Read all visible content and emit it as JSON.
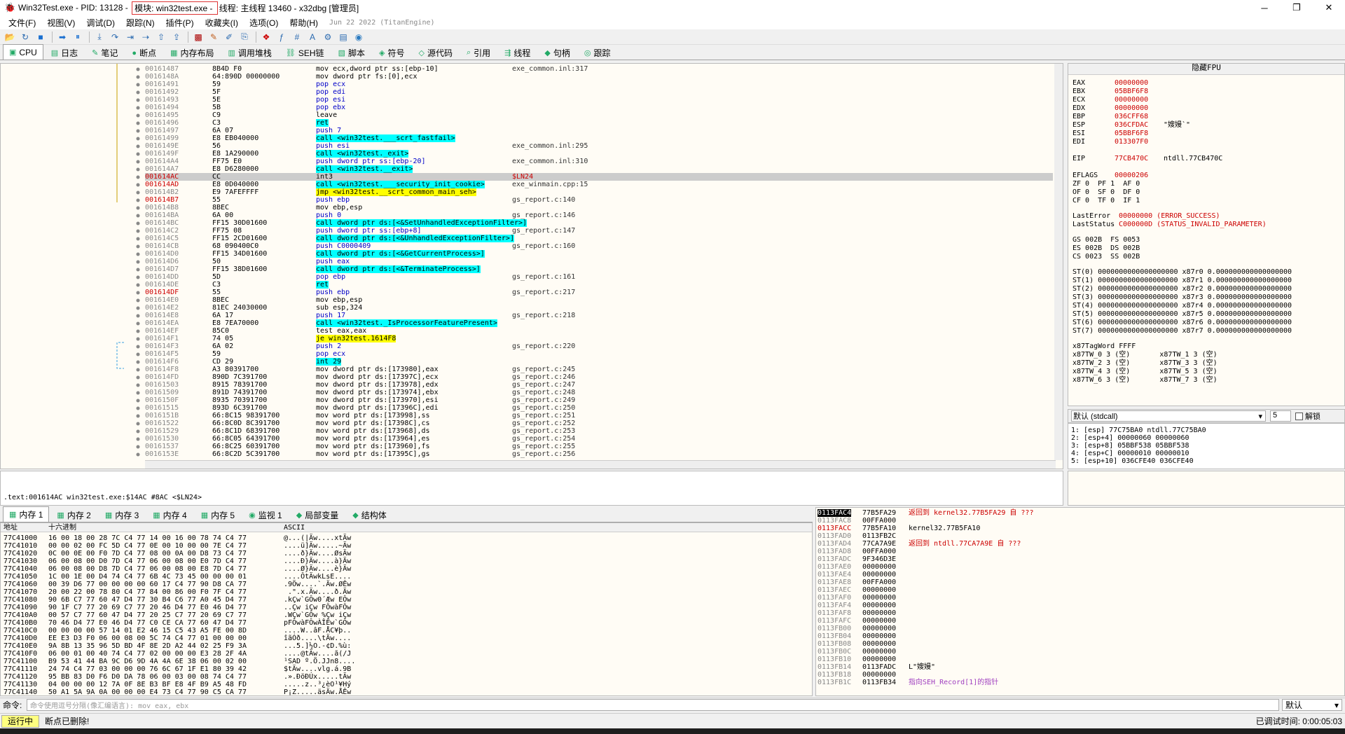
{
  "titlebar": {
    "app": "Win32Test.exe - PID: 13128 - ",
    "module": "模块: win32test.exe - ",
    "thread": "线程: 主线程 13460 - x32dbg [管理员]",
    "buttons": [
      "─",
      "❐",
      "✕"
    ]
  },
  "menu": [
    "文件(F)",
    "视图(V)",
    "调试(D)",
    "跟踪(N)",
    "插件(P)",
    "收藏夹(I)",
    "选项(O)",
    "帮助(H)"
  ],
  "menu_date": "Jun 22 2022 (TitanEngine)",
  "toolbar_icons": [
    "open-icon",
    "restart-icon",
    "stop-icon",
    "run-icon",
    "pause-icon",
    "step-into-icon",
    "step-over-icon",
    "trace-into-icon",
    "trace-over-icon",
    "execute-till-return-icon",
    "run-to-user-code-icon",
    "scylla-icon",
    "patch-icon",
    "comment-icon",
    "label-icon",
    "bookmark-icon",
    "function-icon",
    "hash-icon",
    "font-icon",
    "settings-icon",
    "calculator-icon",
    "globe-icon"
  ],
  "tabs": [
    {
      "label": "CPU",
      "icon": "▣"
    },
    {
      "label": "日志",
      "icon": "▤"
    },
    {
      "label": "笔记",
      "icon": "✎"
    },
    {
      "label": "断点",
      "icon": "●"
    },
    {
      "label": "内存布局",
      "icon": "▦"
    },
    {
      "label": "调用堆栈",
      "icon": "▥"
    },
    {
      "label": "SEH链",
      "icon": "⛓"
    },
    {
      "label": "脚本",
      "icon": "▧"
    },
    {
      "label": "符号",
      "icon": "◈"
    },
    {
      "label": "源代码",
      "icon": "◇"
    },
    {
      "label": "引用",
      "icon": "⌕"
    },
    {
      "label": "线程",
      "icon": "⇶"
    },
    {
      "label": "句柄",
      "icon": "◆"
    },
    {
      "label": "跟踪",
      "icon": "◎"
    }
  ],
  "disasm": [
    [
      "00161487",
      "8B4D F0",
      "mov ecx,dword ptr ss:[ebp-10]",
      "exe_common.inl:317"
    ],
    [
      "0016148A",
      "64:890D 00000000",
      "mov dword ptr fs:[0],ecx",
      ""
    ],
    [
      "00161491",
      "59",
      "pop ecx",
      ""
    ],
    [
      "00161492",
      "5F",
      "pop edi",
      ""
    ],
    [
      "00161493",
      "5E",
      "pop esi",
      ""
    ],
    [
      "00161494",
      "5B",
      "pop ebx",
      ""
    ],
    [
      "00161495",
      "C9",
      "leave",
      ""
    ],
    [
      "00161496",
      "C3",
      "ret",
      ""
    ],
    [
      "00161497",
      "6A 07",
      "push 7",
      ""
    ],
    [
      "00161499",
      "E8 EB040000",
      "call <win32test.___scrt_fastfail>",
      ""
    ],
    [
      "0016149E",
      "56",
      "push esi",
      "exe_common.inl:295"
    ],
    [
      "0016149F",
      "E8 1A290000",
      "call <win32test._exit>",
      ""
    ],
    [
      "001614A4",
      "FF75 E0",
      "push dword ptr ss:[ebp-20]",
      "exe_common.inl:310"
    ],
    [
      "001614A7",
      "E8 D6280000",
      "call <win32test.__exit>",
      ""
    ],
    [
      "001614AC",
      "CC",
      "int3",
      "$LN24"
    ],
    [
      "001614AD",
      "E8 0D040000",
      "call <win32test.___security_init_cookie>",
      "exe_winmain.cpp:15"
    ],
    [
      "001614B2",
      "E9 7AFEFFFF",
      "jmp <win32test.__scrt_common_main_seh>",
      ""
    ],
    [
      "001614B7",
      "55",
      "push ebp",
      "gs_report.c:140"
    ],
    [
      "001614B8",
      "8BEC",
      "mov ebp,esp",
      ""
    ],
    [
      "001614BA",
      "6A 00",
      "push 0",
      "gs_report.c:146"
    ],
    [
      "001614BC",
      "FF15 30D01600",
      "call dword ptr ds:[<&SetUnhandledExceptionFilter>]",
      ""
    ],
    [
      "001614C2",
      "FF75 08",
      "push dword ptr ss:[ebp+8]",
      "gs_report.c:147"
    ],
    [
      "001614C5",
      "FF15 2CD01600",
      "call dword ptr ds:[<&UnhandledExceptionFilter>]",
      ""
    ],
    [
      "001614CB",
      "68 090400C0",
      "push C0000409",
      "gs_report.c:160"
    ],
    [
      "001614D0",
      "FF15 34D01600",
      "call dword ptr ds:[<&GetCurrentProcess>]",
      ""
    ],
    [
      "001614D6",
      "50",
      "push eax",
      ""
    ],
    [
      "001614D7",
      "FF15 38D01600",
      "call dword ptr ds:[<&TerminateProcess>]",
      ""
    ],
    [
      "001614DD",
      "5D",
      "pop ebp",
      "gs_report.c:161"
    ],
    [
      "001614DE",
      "C3",
      "ret",
      ""
    ],
    [
      "001614DF",
      "55",
      "push ebp",
      "gs_report.c:217"
    ],
    [
      "001614E0",
      "8BEC",
      "mov ebp,esp",
      ""
    ],
    [
      "001614E2",
      "81EC 24030000",
      "sub esp,324",
      ""
    ],
    [
      "001614E8",
      "6A 17",
      "push 17",
      "gs_report.c:218"
    ],
    [
      "001614EA",
      "E8 7EA70000",
      "call <win32test._IsProcessorFeaturePresent>",
      ""
    ],
    [
      "001614EF",
      "85C0",
      "test eax,eax",
      ""
    ],
    [
      "001614F1",
      "74 05",
      "je win32test.1614F8",
      ""
    ],
    [
      "001614F3",
      "6A 02",
      "push 2",
      "gs_report.c:220"
    ],
    [
      "001614F5",
      "59",
      "pop ecx",
      ""
    ],
    [
      "001614F6",
      "CD 29",
      "int 29",
      ""
    ],
    [
      "001614F8",
      "A3 80391700",
      "mov dword ptr ds:[173980],eax",
      "gs_report.c:245"
    ],
    [
      "001614FD",
      "890D 7C391700",
      "mov dword ptr ds:[17397C],ecx",
      "gs_report.c:246"
    ],
    [
      "00161503",
      "8915 78391700",
      "mov dword ptr ds:[173978],edx",
      "gs_report.c:247"
    ],
    [
      "00161509",
      "891D 74391700",
      "mov dword ptr ds:[173974],ebx",
      "gs_report.c:248"
    ],
    [
      "0016150F",
      "8935 70391700",
      "mov dword ptr ds:[173970],esi",
      "gs_report.c:249"
    ],
    [
      "00161515",
      "893D 6C391700",
      "mov dword ptr ds:[17396C],edi",
      "gs_report.c:250"
    ],
    [
      "0016151B",
      "66:8C15 98391700",
      "mov word ptr ds:[173998],ss",
      "gs_report.c:251"
    ],
    [
      "00161522",
      "66:8C0D 8C391700",
      "mov word ptr ds:[17398C],cs",
      "gs_report.c:252"
    ],
    [
      "00161529",
      "66:8C1D 68391700",
      "mov word ptr ds:[173968],ds",
      "gs_report.c:253"
    ],
    [
      "00161530",
      "66:8C05 64391700",
      "mov word ptr ds:[173964],es",
      "gs_report.c:254"
    ],
    [
      "00161537",
      "66:8C25 60391700",
      "mov word ptr ds:[173960],fs",
      "gs_report.c:255"
    ],
    [
      "0016153E",
      "66:8C2D 5C391700",
      "mov word ptr ds:[17395C],gs",
      "gs_report.c:256"
    ]
  ],
  "selected_row": 14,
  "red_addr_rows": [
    14,
    15,
    17,
    29
  ],
  "registers": {
    "header": "隐藏FPU",
    "lines": [
      [
        "EAX",
        "00000000",
        ""
      ],
      [
        "EBX",
        "05BBF6F8",
        ""
      ],
      [
        "ECX",
        "00000000",
        ""
      ],
      [
        "EDX",
        "00000000",
        ""
      ],
      [
        "EBP",
        "036CFF68",
        ""
      ],
      [
        "ESP",
        "036CFDAC",
        "\"嫂嫚`\""
      ],
      [
        "ESI",
        "05BBF6F8",
        ""
      ],
      [
        "EDI",
        "013307F0",
        ""
      ],
      [
        "",
        "",
        " "
      ],
      [
        "EIP",
        "77CB470C",
        "ntdll.77CB470C"
      ],
      [
        "",
        "",
        " "
      ],
      [
        "EFLAGS",
        "00000206",
        ""
      ]
    ],
    "flags": [
      "ZF 0  PF 1  AF 0",
      "OF 0  SF 0  DF 0",
      "CF 0  TF 0  IF 1"
    ],
    "last_error_label": "LastError",
    "last_error": "00000000 (ERROR_SUCCESS)",
    "last_status_label": "LastStatus",
    "last_status": "C000000D (STATUS_INVALID_PARAMETER)",
    "segments": [
      "GS 002B  FS 0053",
      "ES 002B  DS 002B",
      "CS 0023  SS 002B"
    ],
    "st": [
      "ST(0) 0000000000000000000 x87r0 0.000000000000000000",
      "ST(1) 0000000000000000000 x87r1 0.000000000000000000",
      "ST(2) 0000000000000000000 x87r2 0.000000000000000000",
      "ST(3) 0000000000000000000 x87r3 0.000000000000000000",
      "ST(4) 0000000000000000000 x87r4 0.000000000000000000",
      "ST(5) 0000000000000000000 x87r5 0.000000000000000000",
      "ST(6) 0000000000000000000 x87r6 0.000000000000000000",
      "ST(7) 0000000000000000000 x87r7 0.000000000000000000"
    ],
    "tagword": "x87TagWord FFFF",
    "tw": [
      "x87TW_0 3 (空)       x87TW_1 3 (空)",
      "x87TW_2 3 (空)       x87TW_3 3 (空)",
      "x87TW_4 3 (空)       x87TW_5 3 (空)",
      "x87TW_6 3 (空)       x87TW_7 3 (空)"
    ]
  },
  "callconv": {
    "value": "默认 (stdcall)",
    "count": "5",
    "unlock": "解锁"
  },
  "args": [
    "1: [esp] 77C75BA0 ntdll.77C75BA0",
    "2: [esp+4] 00000060 00000060",
    "3: [esp+8] 05BBF538 05BBF538",
    "4: [esp+C] 00000010 00000010",
    "5: [esp+10] 036CFE40 036CFE40"
  ],
  "info_line": ".text:001614AC win32test.exe:$14AC #8AC <$LN24>",
  "mem_tabs": [
    "内存 1",
    "内存 2",
    "内存 3",
    "内存 4",
    "内存 5",
    "监视 1",
    "局部变量",
    "结构体"
  ],
  "dump_head": {
    "addr": "地址",
    "hex": "十六进制",
    "ascii": "ASCII"
  },
  "dump": [
    [
      "77C41000",
      "16 00 18 00 28 7C C4 77 14 00 16 00 78 74 C4 77",
      "@...(|Äw....xtÄw"
    ],
    [
      "77C41010",
      "00 00 02 00 FC 5D C4 77 0E 00 10 00 00 7E C4 77",
      "....ü]Äw.....~Äw"
    ],
    [
      "77C41020",
      "0C 00 0E 00 F0 7D C4 77 08 00 0A 00 D8 73 C4 77",
      "....ð}Äw....ØsÄw"
    ],
    [
      "77C41030",
      "06 00 08 00 D0 7D C4 77 06 00 08 00 E0 7D C4 77",
      "....Ð}Äw....à}Äw"
    ],
    [
      "77C41040",
      "06 00 08 00 D8 7D C4 77 06 00 08 00 E8 7D C4 77",
      "....Ø}Äw....è}Äw"
    ],
    [
      "77C41050",
      "1C 00 1E 00 D4 74 C4 77 6B 4C 73 45 00 00 00 01",
      "....ÔtÄwkLsE...."
    ],
    [
      "77C41060",
      "00 39 D6 77 00 00 00 00 60 17 C4 77 90 D8 CA 77",
      ".9Öw....`.Äw.ØÊw"
    ],
    [
      "77C41070",
      "20 00 22 00 78 80 C4 77 84 00 86 00 F0 7F C4 77",
      " .\".x.Äw....ð.Äw"
    ],
    [
      "77C41080",
      "90 6B C7 77 60 47 D4 77 30 B4 C6 77 A0 45 D4 77",
      ".kÇw`GÔw0´Æw EÔw"
    ],
    [
      "77C41090",
      "90 1F C7 77 20 69 C7 77 20 46 D4 77 E0 46 D4 77",
      "..Çw iÇw FÔwàFÔw"
    ],
    [
      "77C410A0",
      "00 57 C7 77 60 47 D4 77 20 25 C7 77 20 69 C7 77",
      ".WÇw`GÔw %Çw iÇw"
    ],
    [
      "77C410B0",
      "70 46 D4 77 E0 46 D4 77 C0 CE CA 77 60 47 D4 77",
      "pFÔwàFÔwÀÎÊw`GÔw"
    ],
    [
      "77C410C0",
      "00 00 00 00 57 14 01 E2 46 15 C5 43 A5 FE 00 8D",
      "....W..âF.ÅC¥þ.."
    ],
    [
      "77C410D0",
      "EE E3 D3 F0 06 00 08 00 5C 74 C4 77 01 00 00 00",
      "îãÓð....\\tÄw...."
    ],
    [
      "77C410E0",
      "9A 8B 13 35 96 5D BD 4F 8E 2D A2 44 02 25 F9 3A",
      "...5.]½O.-¢D.%ù:"
    ],
    [
      "77C410F0",
      "06 00 01 00 40 74 C4 77 02 00 00 00 E3 28 2F 4A",
      "....@tÄw....ã(/J"
    ],
    [
      "77C41100",
      "B9 53 41 44 BA 9C D6 9D 4A 4A 6E 38 06 00 02 00",
      "¹SAD º.Ö.JJn8...."
    ],
    [
      "77C41110",
      "24 74 C4 77 03 00 00 00 76 6C 67 1F E1 80 39 42",
      "$tÄw....vlg.á.9B"
    ],
    [
      "77C41120",
      "95 BB 83 D0 F6 D0 DA 78 06 00 03 00 08 74 C4 77",
      ".».ÐöÐÚx.....tÄw"
    ],
    [
      "77C41130",
      "04 00 00 00 12 7A 0F 8E B3 BF E8 4F B9 A5 48 FD",
      ".....z..³¿èO¹¥Hý"
    ],
    [
      "77C41140",
      "50 A1 5A 9A 0A 00 00 00 E4 73 C4 77 90 C5 CA 77",
      "P¡Z.....äsÄw.ÅÊw"
    ]
  ],
  "stack": [
    [
      "0113FAC4",
      "77B5FA29",
      "返回到 kernel32.77B5FA29 自 ???",
      "red"
    ],
    [
      "0113FAC8",
      "00FFA000",
      "",
      ""
    ],
    [
      "0113FACC",
      "77B5FA10",
      "kernel32.77B5FA10",
      ""
    ],
    [
      "0113FAD0",
      "0113FB2C",
      "",
      ""
    ],
    [
      "0113FAD4",
      "77CA7A9E",
      "返回到 ntdll.77CA7A9E 自 ???",
      "red"
    ],
    [
      "0113FAD8",
      "00FFA000",
      "",
      ""
    ],
    [
      "0113FADC",
      "9F346D3E",
      "",
      ""
    ],
    [
      "0113FAE0",
      "00000000",
      "",
      ""
    ],
    [
      "0113FAE4",
      "00000000",
      "",
      ""
    ],
    [
      "0113FAE8",
      "00FFA000",
      "",
      ""
    ],
    [
      "0113FAEC",
      "00000000",
      "",
      ""
    ],
    [
      "0113FAF0",
      "00000000",
      "",
      ""
    ],
    [
      "0113FAF4",
      "00000000",
      "",
      ""
    ],
    [
      "0113FAF8",
      "00000000",
      "",
      ""
    ],
    [
      "0113FAFC",
      "00000000",
      "",
      ""
    ],
    [
      "0113FB00",
      "00000000",
      "",
      ""
    ],
    [
      "0113FB04",
      "00000000",
      "",
      ""
    ],
    [
      "0113FB08",
      "00000000",
      "",
      ""
    ],
    [
      "0113FB0C",
      "00000000",
      "",
      ""
    ],
    [
      "0113FB10",
      "00000000",
      "",
      ""
    ],
    [
      "0113FB14",
      "0113FADC",
      "L\"嫂嫚\"",
      ""
    ],
    [
      "0113FB18",
      "00000000",
      "",
      ""
    ],
    [
      "0113FB1C",
      "0113FB34",
      "指向SEH_Record[1]的指针",
      "purple"
    ]
  ],
  "cmd": {
    "label": "命令:",
    "placeholder": "命令使用逗号分隔(像汇编语言): mov eax, ebx",
    "mode": "默认"
  },
  "status": {
    "state": "运行中",
    "msg": "断点已删除!",
    "time": "已调试时间:  0:00:05:03"
  },
  "colors": {
    "accent_red": "#c00000",
    "call_bg": "#00ffff",
    "jmp_bg": "#ffff00",
    "selected": "#cccccc"
  }
}
